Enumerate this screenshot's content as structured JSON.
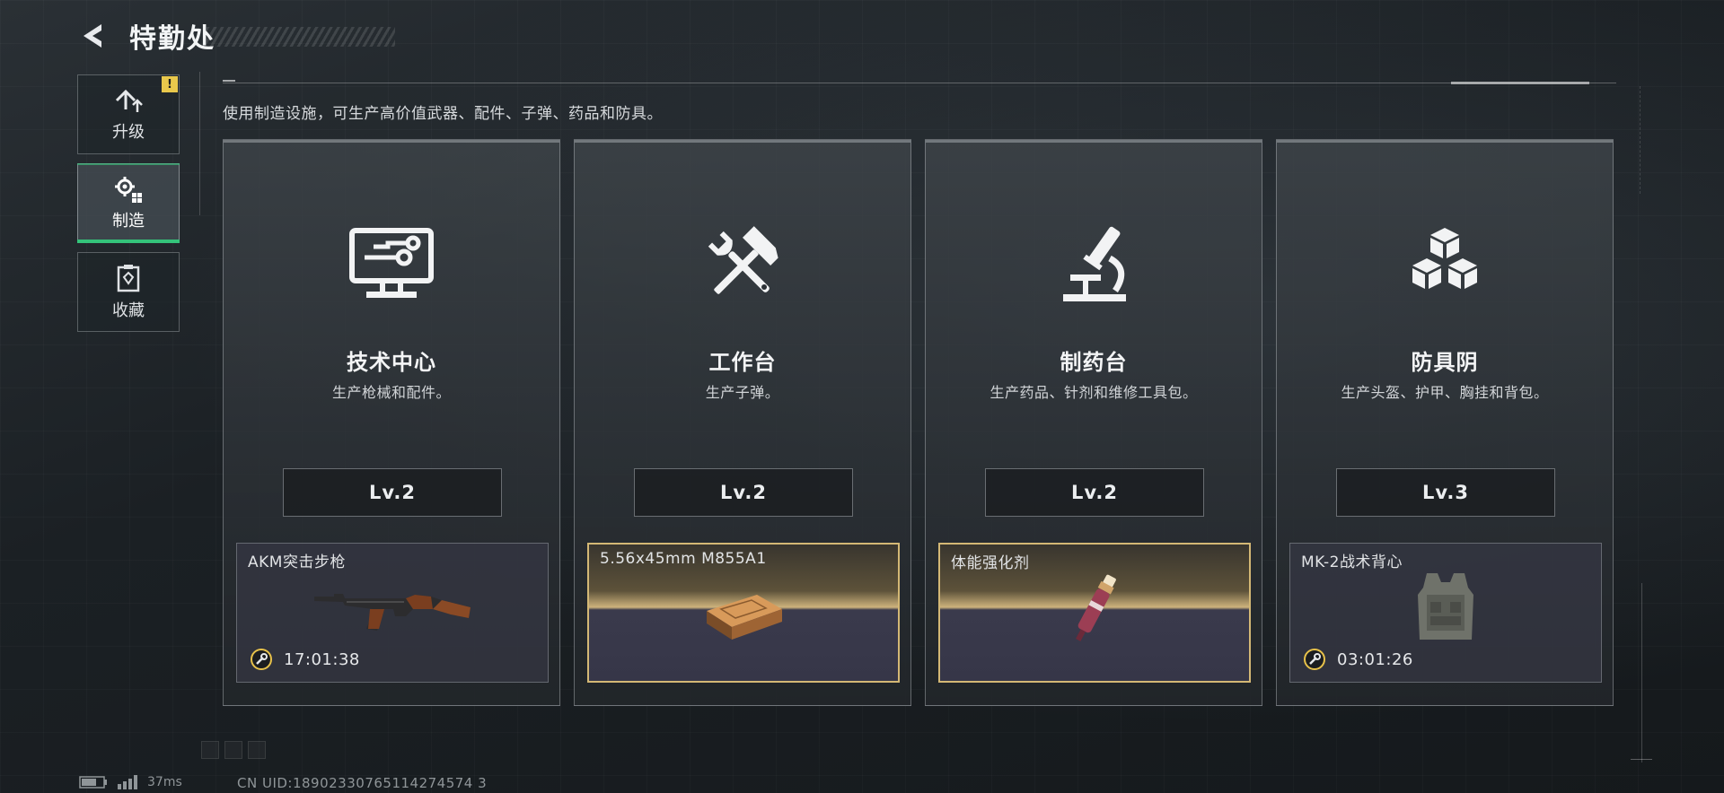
{
  "header": {
    "back_icon": "chevron-left-icon",
    "title": "特勤处"
  },
  "sidebar": {
    "items": [
      {
        "label": "升级",
        "icon": "upgrade-arrow-icon",
        "badge": "!",
        "active": false
      },
      {
        "label": "制造",
        "icon": "gears-icon",
        "active": true
      },
      {
        "label": "收藏",
        "icon": "collection-icon",
        "active": false
      }
    ]
  },
  "description": "使用制造设施，可生产高价值武器、配件、子弹、药品和防具。",
  "stations": [
    {
      "name": "技术中心",
      "desc": "生产枪械和配件。",
      "icon": "computer-monitor-icon",
      "level": "Lv.2",
      "product": {
        "name": "AKM突击步枪",
        "image": "rifle-icon",
        "timer": "17:01:38",
        "state": "in-progress"
      }
    },
    {
      "name": "工作台",
      "desc": "生产子弹。",
      "icon": "hammer-wrench-icon",
      "level": "Lv.2",
      "product": {
        "name": "5.56x45mm M855A1",
        "image": "ammo-box-icon",
        "state": "completed"
      }
    },
    {
      "name": "制药台",
      "desc": "生产药品、针剂和维修工具包。",
      "icon": "microscope-icon",
      "level": "Lv.2",
      "product": {
        "name": "体能强化剂",
        "image": "injector-icon",
        "state": "completed"
      }
    },
    {
      "name": "防具阴",
      "desc": "生产头盔、护甲、胸挂和背包。",
      "icon": "cubes-icon",
      "level": "Lv.3",
      "product": {
        "name": "MK-2战术背心",
        "image": "vest-icon",
        "timer": "03:01:26",
        "state": "in-progress"
      }
    }
  ],
  "status": {
    "ping": "37ms",
    "uid": "CN UID:18902330765114274574 3"
  },
  "colors": {
    "accent_green": "#34c37a",
    "badge_yellow": "#e9c84c",
    "gold_border": "#d4b875",
    "timer_ring": "#e8c24a"
  }
}
